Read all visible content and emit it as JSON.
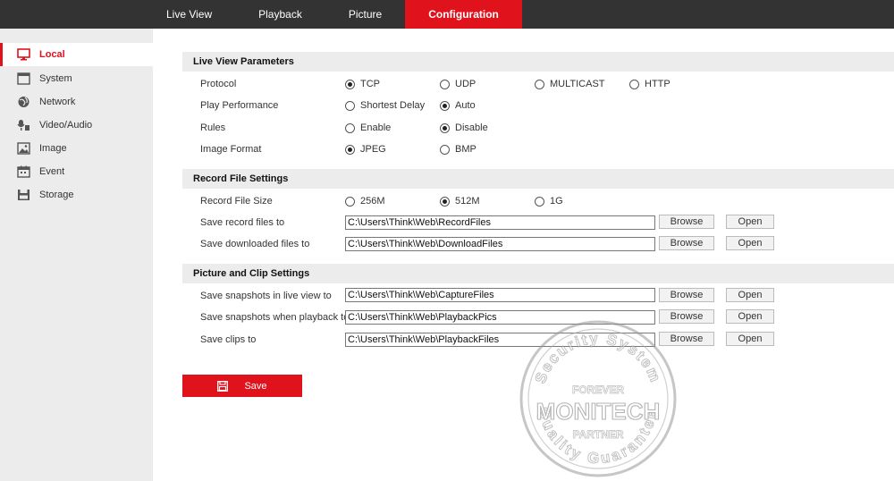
{
  "nav": {
    "tabs": [
      {
        "label": "Live View"
      },
      {
        "label": "Playback"
      },
      {
        "label": "Picture"
      },
      {
        "label": "Configuration"
      }
    ]
  },
  "sidebar": {
    "items": [
      {
        "label": "Local",
        "icon": "monitor-icon"
      },
      {
        "label": "System",
        "icon": "window-icon"
      },
      {
        "label": "Network",
        "icon": "globe-icon"
      },
      {
        "label": "Video/Audio",
        "icon": "mic-icon"
      },
      {
        "label": "Image",
        "icon": "image-icon"
      },
      {
        "label": "Event",
        "icon": "calendar-icon"
      },
      {
        "label": "Storage",
        "icon": "disk-icon"
      }
    ]
  },
  "live_view": {
    "title": "Live View Parameters",
    "protocol": {
      "label": "Protocol",
      "options": [
        "TCP",
        "UDP",
        "MULTICAST",
        "HTTP"
      ],
      "selected": "TCP"
    },
    "play_performance": {
      "label": "Play Performance",
      "options": [
        "Shortest Delay",
        "Auto"
      ],
      "selected": "Auto"
    },
    "rules": {
      "label": "Rules",
      "options": [
        "Enable",
        "Disable"
      ],
      "selected": "Disable"
    },
    "image_format": {
      "label": "Image Format",
      "options": [
        "JPEG",
        "BMP"
      ],
      "selected": "JPEG"
    }
  },
  "record": {
    "title": "Record File Settings",
    "file_size": {
      "label": "Record File Size",
      "options": [
        "256M",
        "512M",
        "1G"
      ],
      "selected": "512M"
    },
    "save_record": {
      "label": "Save record files to",
      "value": "C:\\Users\\Think\\Web\\RecordFiles"
    },
    "save_downloaded": {
      "label": "Save downloaded files to",
      "value": "C:\\Users\\Think\\Web\\DownloadFiles"
    }
  },
  "picture": {
    "title": "Picture and Clip Settings",
    "snap_live": {
      "label": "Save snapshots in live view to",
      "value": "C:\\Users\\Think\\Web\\CaptureFiles"
    },
    "snap_playback": {
      "label": "Save snapshots when playback to",
      "value": "C:\\Users\\Think\\Web\\PlaybackPics"
    },
    "clips": {
      "label": "Save clips to",
      "value": "C:\\Users\\Think\\Web\\PlaybackFiles"
    }
  },
  "buttons": {
    "browse": "Browse",
    "open": "Open",
    "save": "Save"
  },
  "watermark": {
    "arc_top": "Security System",
    "line1": "FOREVER",
    "brand": "MONITECH",
    "line2": "PARTNER",
    "arc_bottom": "Quality Guarantee"
  },
  "colors": {
    "accent": "#e0121c",
    "topbar": "#333333",
    "sidebar": "#ececec"
  }
}
